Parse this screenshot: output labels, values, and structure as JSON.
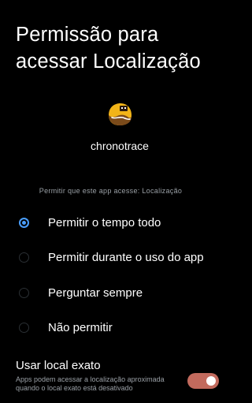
{
  "dialog": {
    "title": "Permissão para acessar Localização",
    "app_icon": "chronotrace-app-icon",
    "app_name": "chronotrace",
    "prompt": "Permitir que este app acesse: Localização"
  },
  "options": [
    {
      "label": "Permitir o tempo todo",
      "selected": true
    },
    {
      "label": "Permitir durante o uso do app",
      "selected": false
    },
    {
      "label": "Perguntar sempre",
      "selected": false
    },
    {
      "label": "Não permitir",
      "selected": false
    }
  ],
  "precise_location": {
    "title": "Usar local exato",
    "description": "Apps podem acessar a localização aproximada quando o local exato está desativado",
    "enabled": true
  },
  "colors": {
    "background": "#000000",
    "accent": "#4a9eff",
    "toggle_on": "#c26a5d",
    "secondary_text": "#9aa0a6"
  }
}
